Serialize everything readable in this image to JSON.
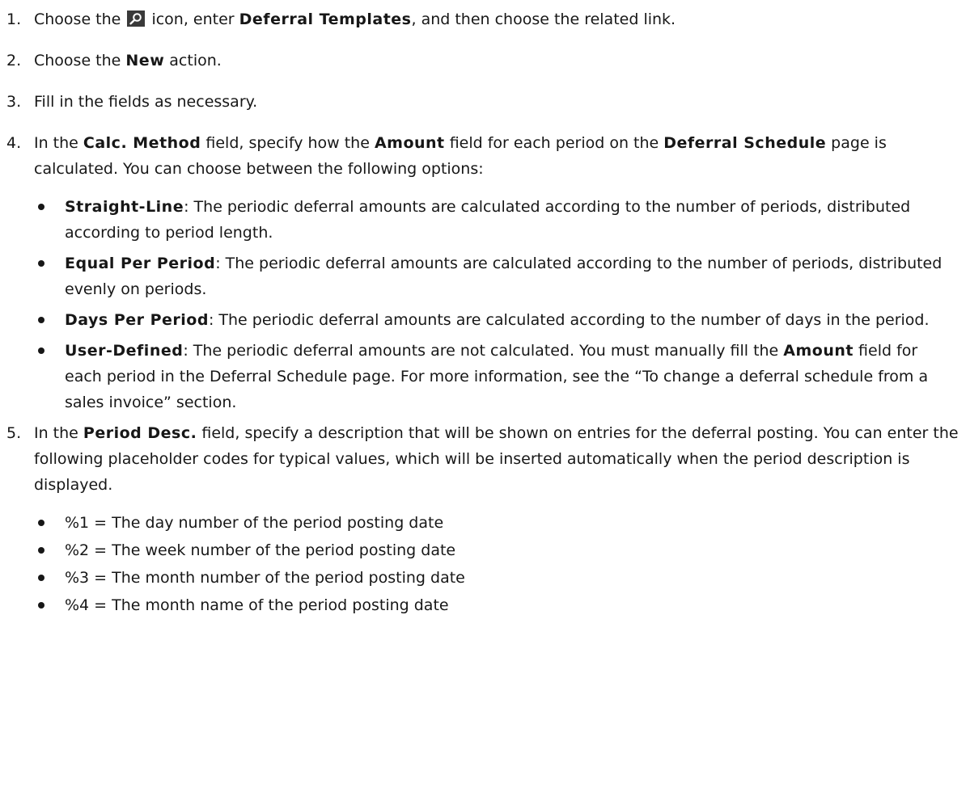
{
  "steps": [
    {
      "number": "1.",
      "parts": [
        {
          "t": "Choose the "
        },
        {
          "icon": "search-icon"
        },
        {
          "t": " icon, enter "
        },
        {
          "b": "Deferral Templates"
        },
        {
          "t": ", and then choose the related link."
        }
      ]
    },
    {
      "number": "2.",
      "parts": [
        {
          "t": "Choose the "
        },
        {
          "b": "New"
        },
        {
          "t": " action."
        }
      ]
    },
    {
      "number": "3.",
      "parts": [
        {
          "t": "Fill in the fields as necessary."
        }
      ]
    },
    {
      "number": "4.",
      "parts": [
        {
          "t": "In the "
        },
        {
          "b": "Calc. Method"
        },
        {
          "t": " field, specify how the "
        },
        {
          "b": "Amount"
        },
        {
          "t": " field for each period on the "
        },
        {
          "b": "Deferral Schedule"
        },
        {
          "t": " page is calculated. You can choose between the following options:"
        }
      ],
      "bullets": [
        [
          {
            "b": "Straight-Line"
          },
          {
            "t": ": The periodic deferral amounts are calculated according to the number of periods, distributed according to period length."
          }
        ],
        [
          {
            "b": "Equal Per Period"
          },
          {
            "t": ": The periodic deferral amounts are calculated according to the number of periods, distributed evenly on periods."
          }
        ],
        [
          {
            "b": "Days Per Period"
          },
          {
            "t": ": The periodic deferral amounts are calculated according to the number of days in the period."
          }
        ],
        [
          {
            "b": "User-Defined"
          },
          {
            "t": ": The periodic deferral amounts are not calculated. You must manually fill the "
          },
          {
            "b": "Amount"
          },
          {
            "t": " field for each period in the Deferral Schedule page. For more information, see the “To change a deferral schedule from a sales invoice” section."
          }
        ]
      ]
    },
    {
      "number": "5.",
      "parts": [
        {
          "t": "In the "
        },
        {
          "b": "Period Desc."
        },
        {
          "t": " field, specify a description that will be shown on entries for the deferral posting. You can enter the following placeholder codes for typical values, which will be inserted automatically when the period description is displayed."
        }
      ],
      "bullets": [
        [
          {
            "t": "%1 = The day number of the period posting date"
          }
        ],
        [
          {
            "t": "%2 = The week number of the period posting date"
          }
        ],
        [
          {
            "t": "%3 = The month number of the period posting date"
          }
        ],
        [
          {
            "t": "%4 = The month name of the period posting date"
          }
        ]
      ]
    }
  ]
}
